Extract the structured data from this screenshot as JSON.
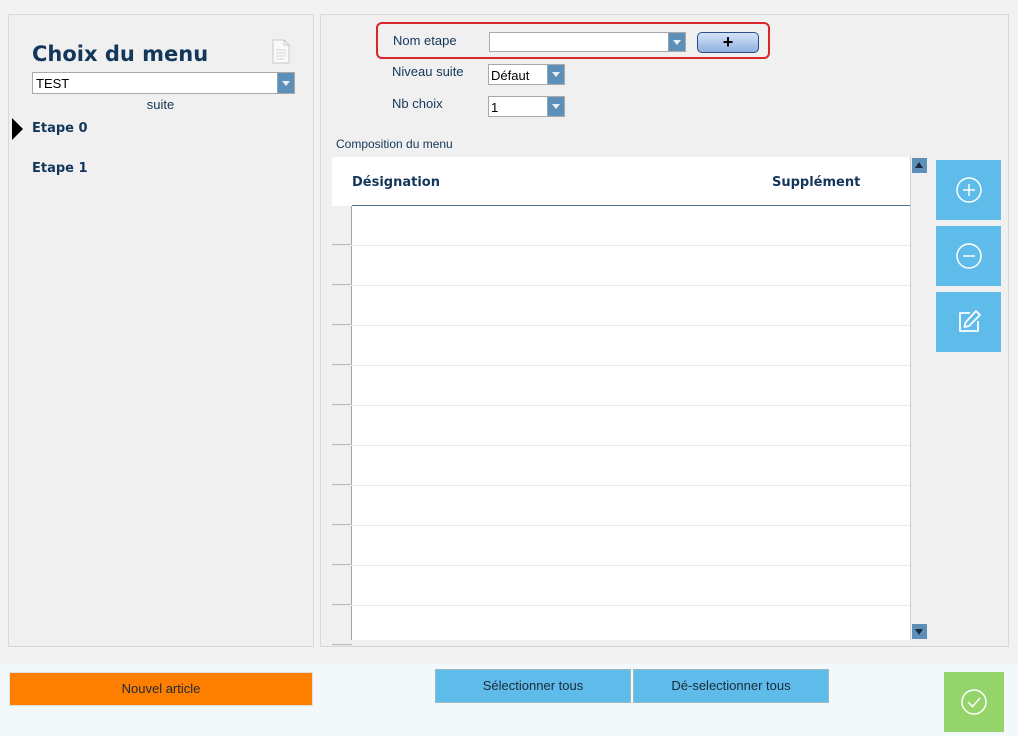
{
  "left": {
    "title": "Choix du menu",
    "menu_selected": "TEST",
    "suite_label": "suite",
    "etapes": [
      "Etape 0",
      "Etape 1"
    ]
  },
  "form": {
    "nom_etape_label": "Nom etape",
    "nom_etape_value": "",
    "add_button": "+",
    "niveau_suite_label": "Niveau suite",
    "niveau_suite_value": "Défaut",
    "nb_choix_label": "Nb choix",
    "nb_choix_value": "1"
  },
  "table": {
    "section_label": "Composition du menu",
    "columns": [
      "Désignation",
      "Supplément"
    ]
  },
  "bottom": {
    "nouvel_article": "Nouvel article",
    "select_all": "Sélectionner tous",
    "deselect_all": "Dé-selectionner tous"
  },
  "colors": {
    "accent_blue": "#5fbbe9",
    "orange": "#fe7f00",
    "green": "#94d46a",
    "highlight_red": "#d8262b",
    "title_navy": "#13375a"
  }
}
